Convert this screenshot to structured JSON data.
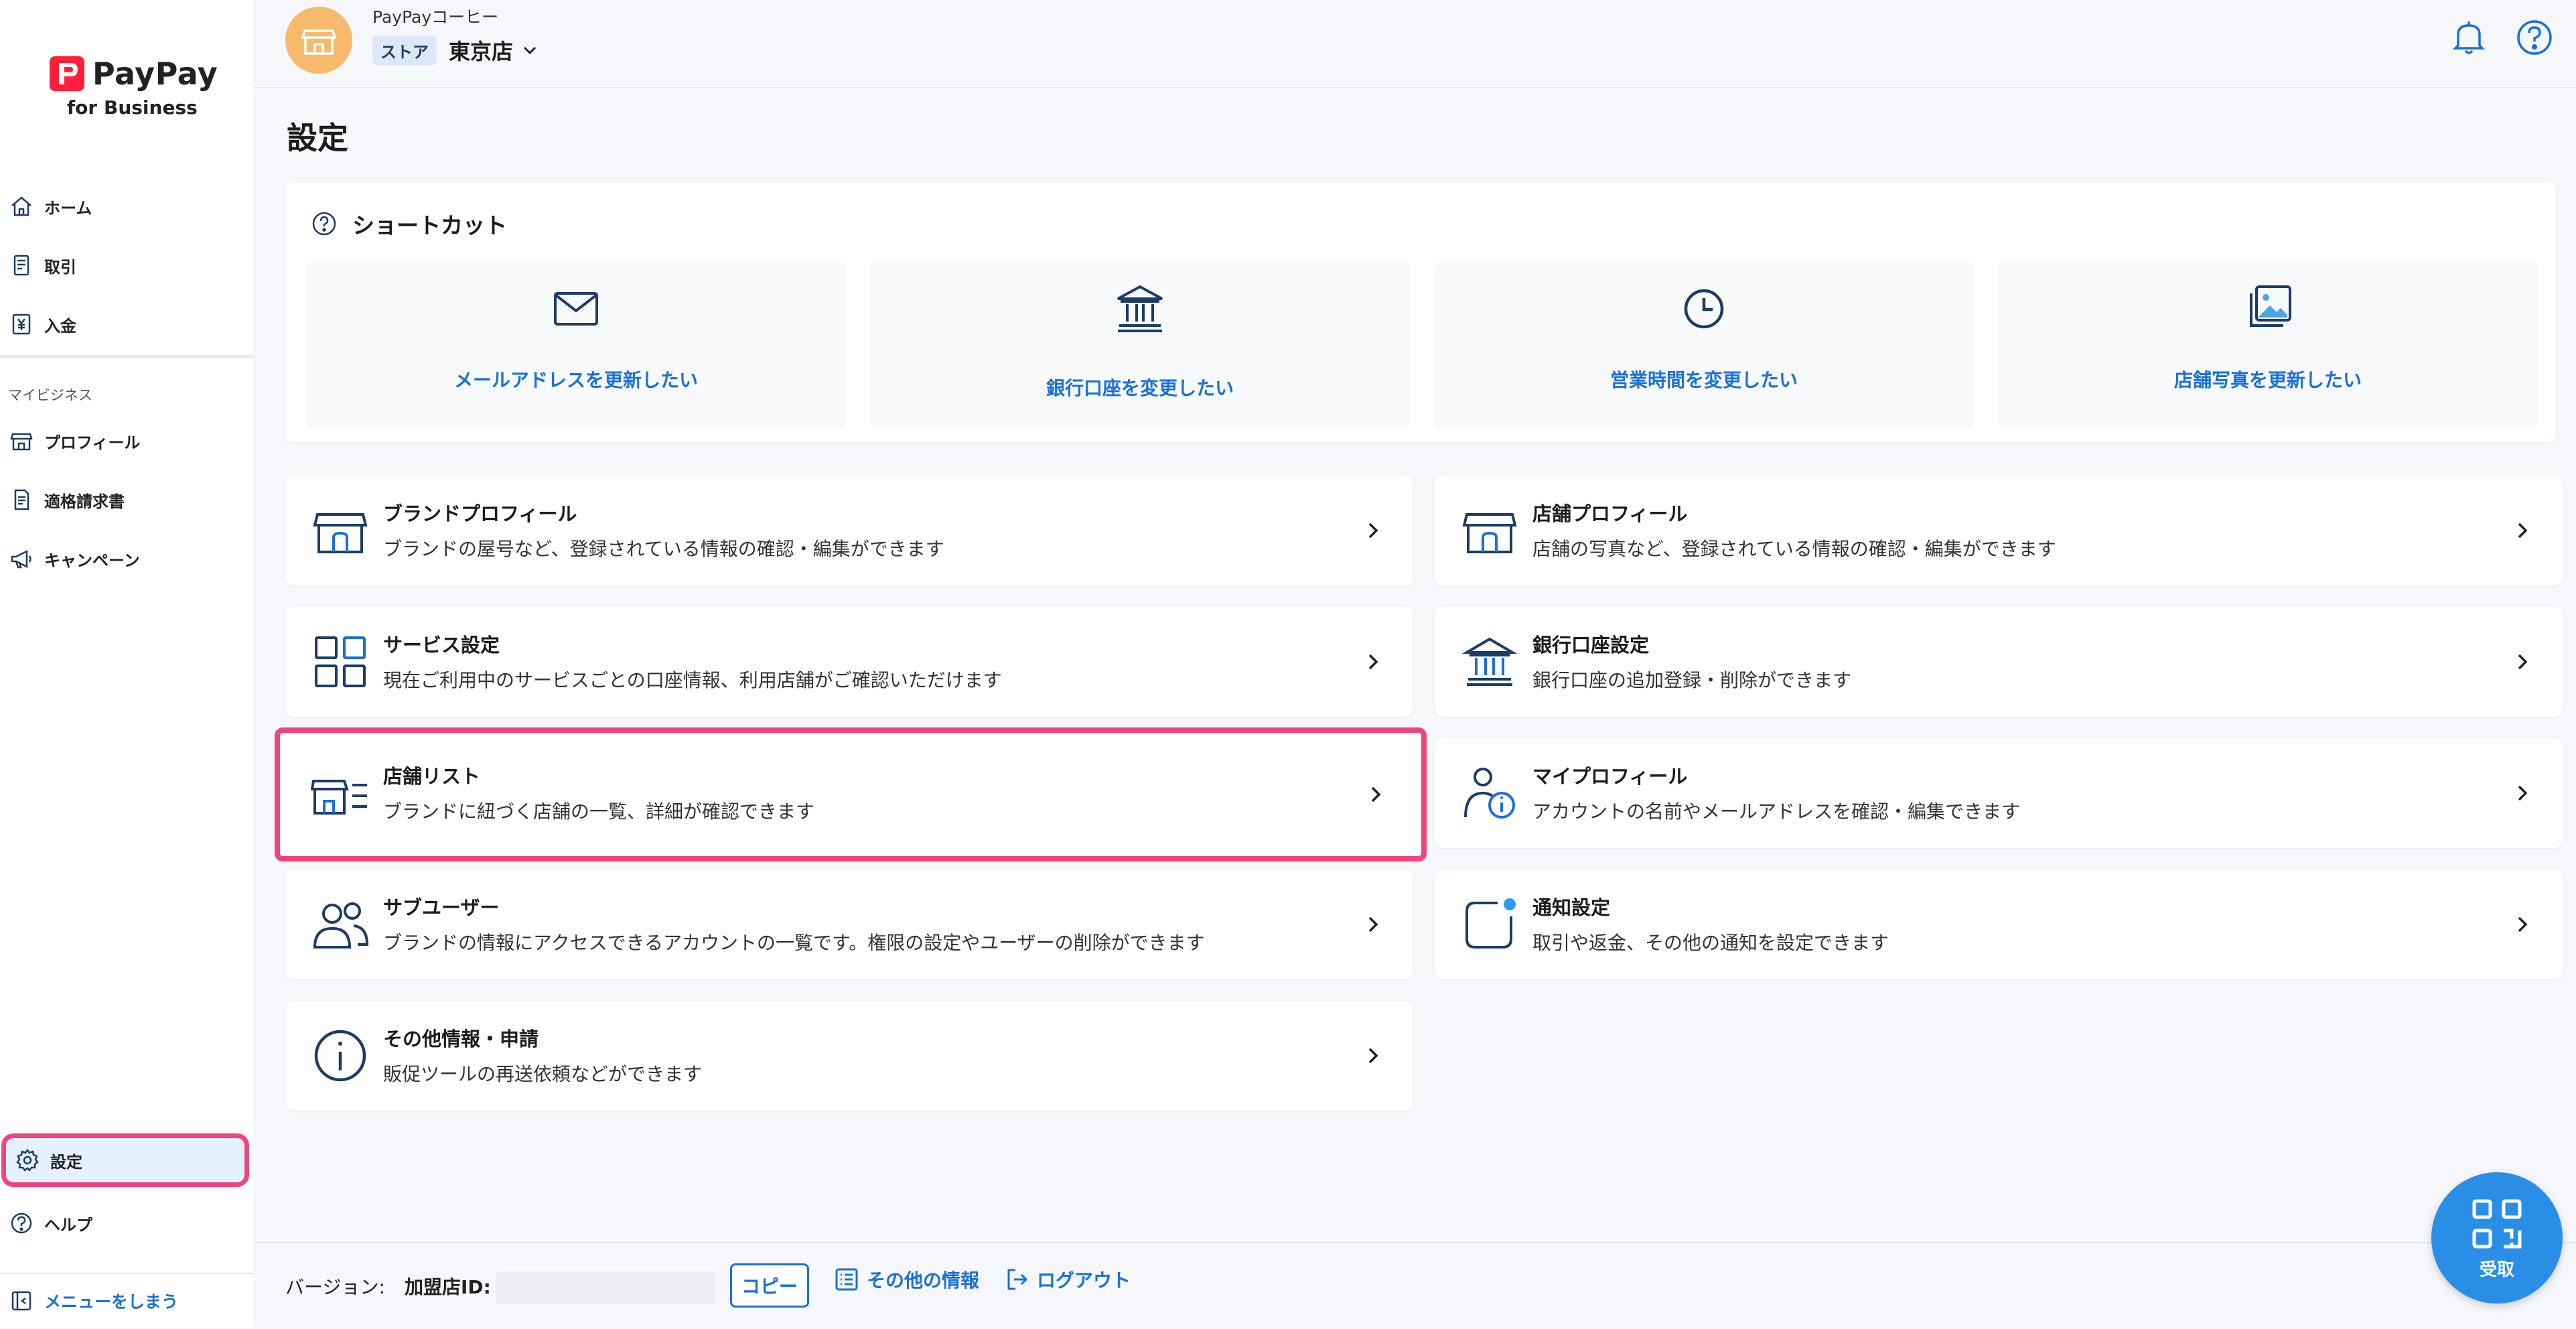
{
  "app": {
    "logo_name": "PayPay",
    "logo_sub": "for Business"
  },
  "colors": {
    "accent": "#1a6fd9",
    "highlight": "#f0457c",
    "avatar": "#f7b96a",
    "fab": "#2a8ee6"
  },
  "sidebar": {
    "items": [
      {
        "label": "ホーム",
        "icon": "home-icon"
      },
      {
        "label": "取引",
        "icon": "receipt-icon"
      },
      {
        "label": "入金",
        "icon": "yen-icon"
      }
    ],
    "section_label": "マイビジネス",
    "business_items": [
      {
        "label": "プロフィール",
        "icon": "store-icon"
      },
      {
        "label": "適格請求書",
        "icon": "invoice-icon"
      },
      {
        "label": "キャンペーン",
        "icon": "megaphone-icon"
      }
    ],
    "settings_label": "設定",
    "help_label": "ヘルプ",
    "collapse_label": "メニューをしまう"
  },
  "header": {
    "brand": "PayPayコーヒー",
    "badge": "ストア",
    "store": "東京店"
  },
  "page": {
    "title": "設定"
  },
  "shortcuts": {
    "title": "ショートカット",
    "items": [
      {
        "label": "メールアドレスを更新したい",
        "icon": "mail-icon"
      },
      {
        "label": "銀行口座を変更したい",
        "icon": "bank-icon"
      },
      {
        "label": "営業時間を変更したい",
        "icon": "clock-icon"
      },
      {
        "label": "店舗写真を更新したい",
        "icon": "photos-icon"
      }
    ]
  },
  "cards": [
    {
      "title": "ブランドプロフィール",
      "desc": "ブランドの屋号など、登録されている情報の確認・編集ができます",
      "icon": "store-icon"
    },
    {
      "title": "店舗プロフィール",
      "desc": "店舗の写真など、登録されている情報の確認・編集ができます",
      "icon": "store-icon"
    },
    {
      "title": "サービス設定",
      "desc": "現在ご利用中のサービスごとの口座情報、利用店舗がご確認いただけます",
      "icon": "grid-icon"
    },
    {
      "title": "銀行口座設定",
      "desc": "銀行口座の追加登録・削除ができます",
      "icon": "bank-icon"
    },
    {
      "title": "店舗リスト",
      "desc": "ブランドに紐づく店舗の一覧、詳細が確認できます",
      "icon": "store-list-icon"
    },
    {
      "title": "マイプロフィール",
      "desc": "アカウントの名前やメールアドレスを確認・編集できます",
      "icon": "user-info-icon"
    },
    {
      "title": "サブユーザー",
      "desc": "ブランドの情報にアクセスできるアカウントの一覧です。権限の設定やユーザーの削除ができます",
      "icon": "users-icon"
    },
    {
      "title": "通知設定",
      "desc": "取引や返金、その他の通知を設定できます",
      "icon": "notification-icon"
    },
    {
      "title": "その他情報・申請",
      "desc": "販促ツールの再送依頼などができます",
      "icon": "info-icon"
    }
  ],
  "footer": {
    "version_label": "バージョン:",
    "merchant_label": "加盟店ID:",
    "copy_label": "コピー",
    "other_info_label": "その他の情報",
    "logout_label": "ログアウト"
  },
  "fab": {
    "label": "受取"
  }
}
